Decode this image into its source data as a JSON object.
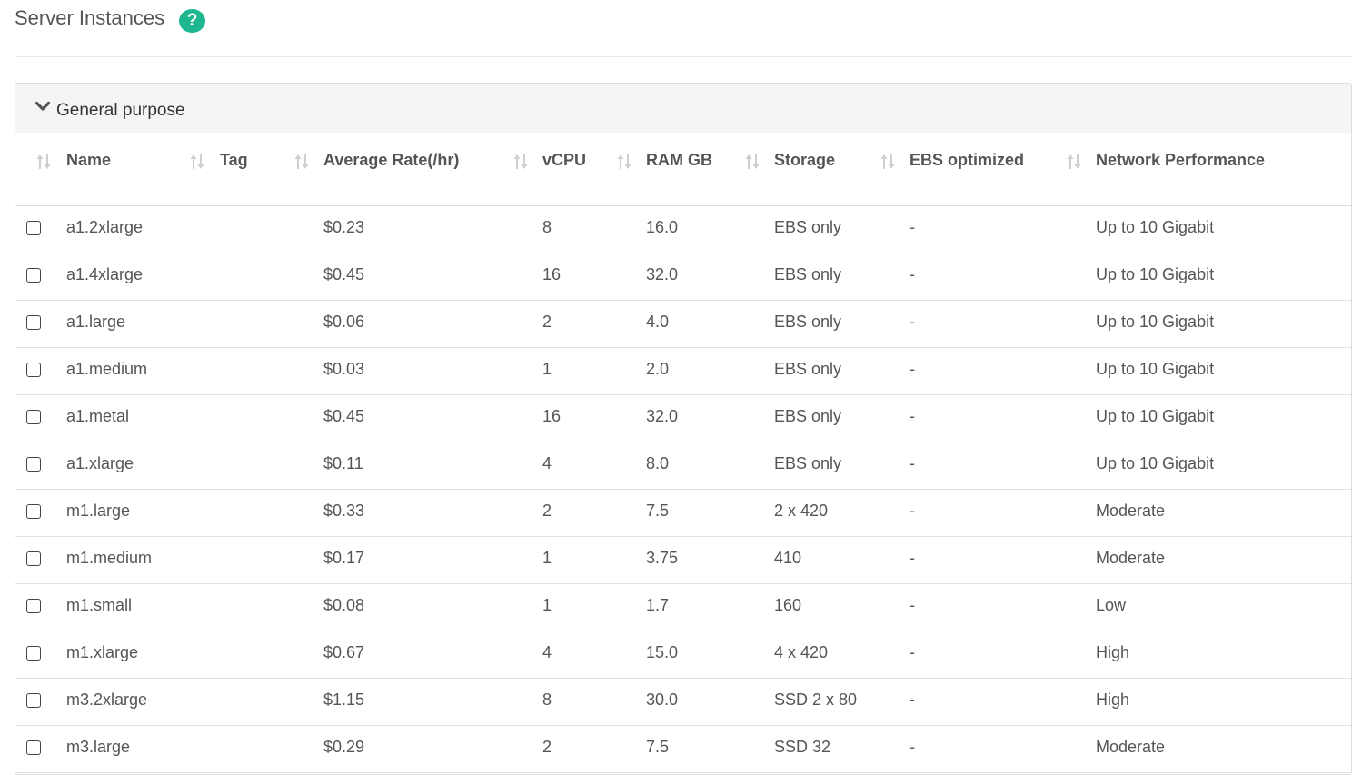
{
  "header": {
    "title": "Server Instances",
    "help_icon": "question-circle-icon",
    "help_symbol": "?",
    "help_color": "#1fb78f"
  },
  "panel": {
    "title": "General purpose",
    "toggle_icon": "chevron-down-icon"
  },
  "table": {
    "columns": [
      {
        "key": "name",
        "label": "Name",
        "sort_icon": "sort-icon"
      },
      {
        "key": "tag",
        "label": "Tag",
        "sort_icon": "sort-icon"
      },
      {
        "key": "rate",
        "label": "Average Rate(/hr)",
        "sort_icon": "sort-icon"
      },
      {
        "key": "vcpu",
        "label": "vCPU",
        "sort_icon": "sort-icon"
      },
      {
        "key": "ram",
        "label": "RAM GB",
        "sort_icon": "sort-icon"
      },
      {
        "key": "storage",
        "label": "Storage",
        "sort_icon": "sort-icon"
      },
      {
        "key": "ebs",
        "label": "EBS optimized",
        "sort_icon": "sort-icon"
      },
      {
        "key": "network",
        "label": "Network Performance",
        "sort_icon": "sort-icon"
      }
    ],
    "rows": [
      {
        "name": "a1.2xlarge",
        "tag": "",
        "rate": "$0.23",
        "vcpu": "8",
        "ram": "16.0",
        "storage": "EBS only",
        "ebs": "-",
        "network": "Up to 10 Gigabit"
      },
      {
        "name": "a1.4xlarge",
        "tag": "",
        "rate": "$0.45",
        "vcpu": "16",
        "ram": "32.0",
        "storage": "EBS only",
        "ebs": "-",
        "network": "Up to 10 Gigabit"
      },
      {
        "name": "a1.large",
        "tag": "",
        "rate": "$0.06",
        "vcpu": "2",
        "ram": "4.0",
        "storage": "EBS only",
        "ebs": "-",
        "network": "Up to 10 Gigabit"
      },
      {
        "name": "a1.medium",
        "tag": "",
        "rate": "$0.03",
        "vcpu": "1",
        "ram": "2.0",
        "storage": "EBS only",
        "ebs": "-",
        "network": "Up to 10 Gigabit"
      },
      {
        "name": "a1.metal",
        "tag": "",
        "rate": "$0.45",
        "vcpu": "16",
        "ram": "32.0",
        "storage": "EBS only",
        "ebs": "-",
        "network": "Up to 10 Gigabit"
      },
      {
        "name": "a1.xlarge",
        "tag": "",
        "rate": "$0.11",
        "vcpu": "4",
        "ram": "8.0",
        "storage": "EBS only",
        "ebs": "-",
        "network": "Up to 10 Gigabit"
      },
      {
        "name": "m1.large",
        "tag": "",
        "rate": "$0.33",
        "vcpu": "2",
        "ram": "7.5",
        "storage": "2 x 420",
        "ebs": "-",
        "network": "Moderate"
      },
      {
        "name": "m1.medium",
        "tag": "",
        "rate": "$0.17",
        "vcpu": "1",
        "ram": "3.75",
        "storage": "410",
        "ebs": "-",
        "network": "Moderate"
      },
      {
        "name": "m1.small",
        "tag": "",
        "rate": "$0.08",
        "vcpu": "1",
        "ram": "1.7",
        "storage": "160",
        "ebs": "-",
        "network": "Low"
      },
      {
        "name": "m1.xlarge",
        "tag": "",
        "rate": "$0.67",
        "vcpu": "4",
        "ram": "15.0",
        "storage": "4 x 420",
        "ebs": "-",
        "network": "High"
      },
      {
        "name": "m3.2xlarge",
        "tag": "",
        "rate": "$1.15",
        "vcpu": "8",
        "ram": "30.0",
        "storage": "SSD 2 x 80",
        "ebs": "-",
        "network": "High"
      },
      {
        "name": "m3.large",
        "tag": "",
        "rate": "$0.29",
        "vcpu": "2",
        "ram": "7.5",
        "storage": "SSD 32",
        "ebs": "-",
        "network": "Moderate"
      }
    ]
  }
}
